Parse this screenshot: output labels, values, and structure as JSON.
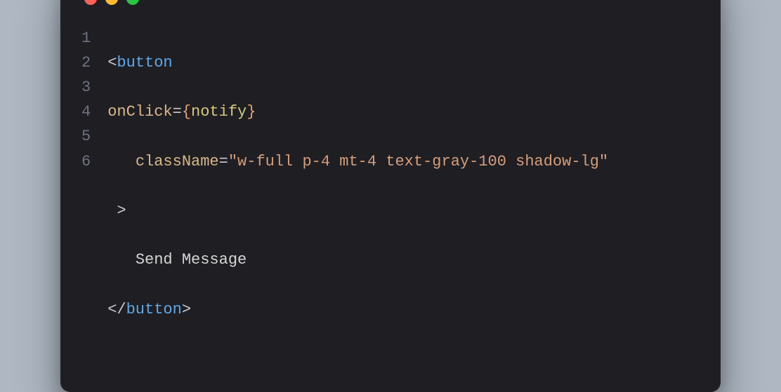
{
  "window": {
    "dots": [
      "red",
      "yellow",
      "green"
    ]
  },
  "code": {
    "lineNumbers": [
      "1",
      "2",
      "3",
      "4",
      "5",
      "6"
    ],
    "line1_open": "<",
    "line1_tag": "button",
    "line2_attr": "onClick",
    "line2_eq": "=",
    "line2_lbrace": "{",
    "line2_ident": "notify",
    "line2_rbrace": "}",
    "line3_indent": "   ",
    "line3_attr": "className",
    "line3_eq": "=",
    "line3_string": "\"w-full p-4 mt-4 text-gray-100 shadow-lg\"",
    "line4_indent": " ",
    "line4_gt": ">",
    "line5_indent": "   ",
    "line5_text": "Send Message",
    "line6_open": "</",
    "line6_tag": "button",
    "line6_gt": ">"
  }
}
